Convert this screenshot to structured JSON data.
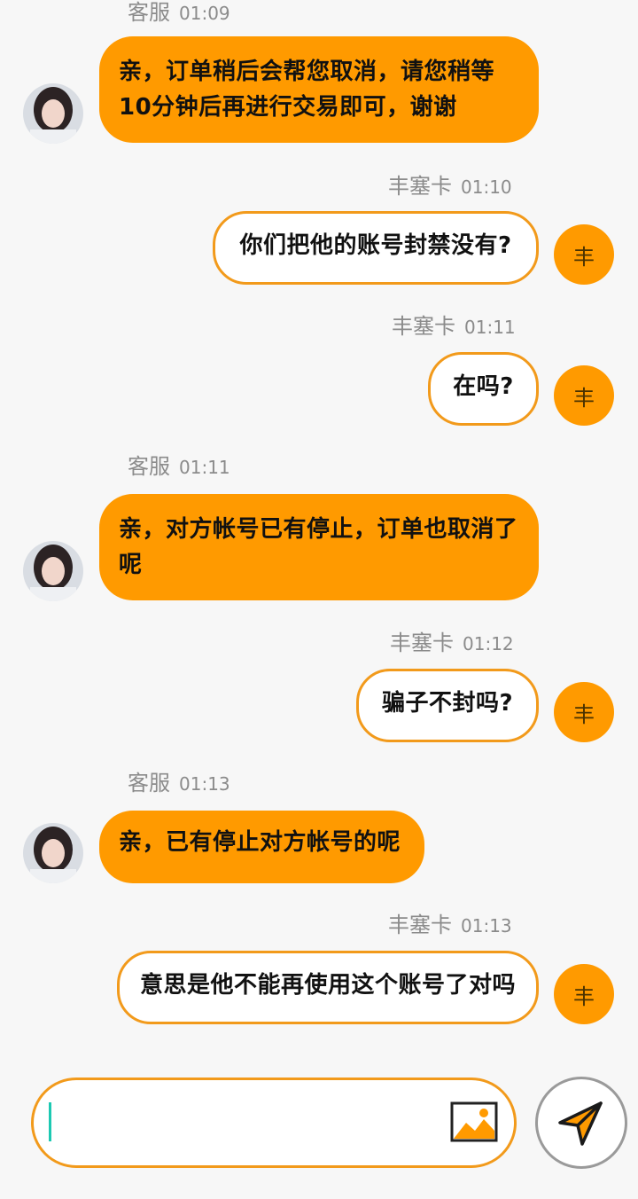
{
  "agent_name": "客服",
  "user_name": "丰塞卡",
  "user_avatar_letter": "丰",
  "messages": [
    {
      "sender": "客服",
      "time": "01:09",
      "text": "亲，订单稍后会帮您取消，请您稍等10分钟后再进行交易即可，谢谢"
    },
    {
      "sender": "丰塞卡",
      "time": "01:10",
      "text": "你们把他的账号封禁没有?"
    },
    {
      "sender": "丰塞卡",
      "time": "01:11",
      "text": "在吗?"
    },
    {
      "sender": "客服",
      "time": "01:11",
      "text": "亲，对方帐号已有停止，订单也取消了呢"
    },
    {
      "sender": "丰塞卡",
      "time": "01:12",
      "text": "骗子不封吗?"
    },
    {
      "sender": "客服",
      "time": "01:13",
      "text": "亲，已有停止对方帐号的呢"
    },
    {
      "sender": "丰塞卡",
      "time": "01:13",
      "text": "意思是他不能再使用这个账号了对吗"
    }
  ],
  "input": {
    "value": ""
  },
  "icons": {
    "image": "image-icon",
    "send": "send-icon"
  },
  "colors": {
    "accent": "#ff9a00",
    "border": "#f29a1b",
    "caret": "#1cc9b2"
  }
}
